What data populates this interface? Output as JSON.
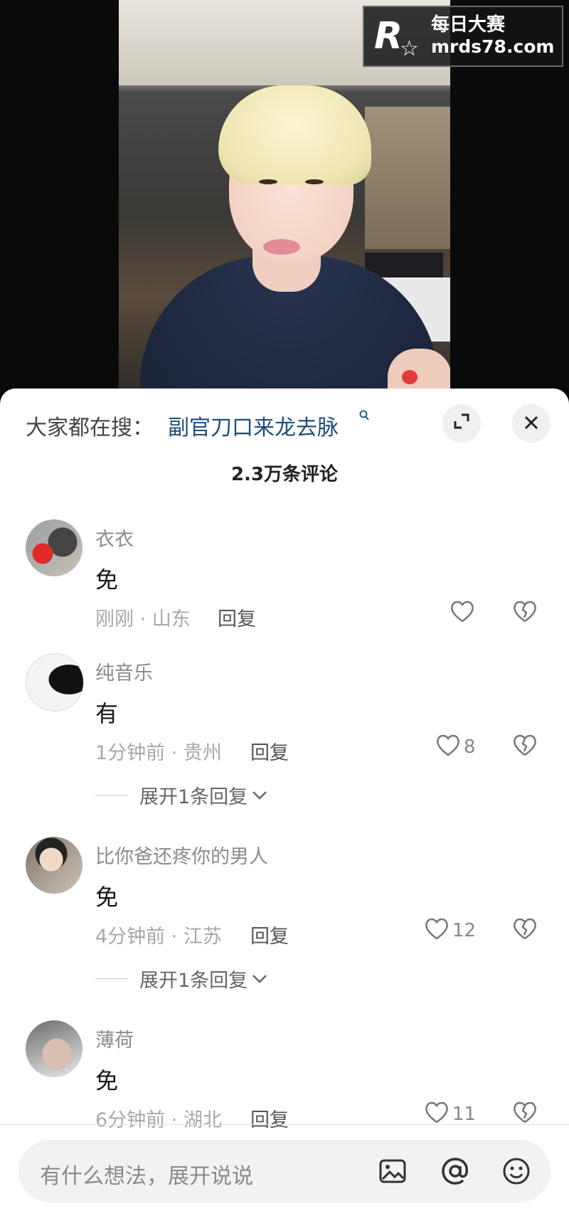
{
  "watermark": {
    "logo_letter": "R",
    "cn_text": "每日大赛",
    "url": "mrds78.com"
  },
  "sheet": {
    "search_prefix": "大家都在搜：",
    "search_query": "副官刀口来龙去脉",
    "comment_count": "2.3万条评论"
  },
  "comments": [
    {
      "name": "衣衣",
      "text": "免",
      "time": "刚刚",
      "location": "山东",
      "reply_label": "回复",
      "likes": ""
    },
    {
      "name": "纯音乐",
      "text": "有",
      "time": "1分钟前",
      "location": "贵州",
      "reply_label": "回复",
      "likes": "8",
      "expand": "展开1条回复"
    },
    {
      "name": "比你爸还疼你的男人",
      "text": "免",
      "time": "4分钟前",
      "location": "江苏",
      "reply_label": "回复",
      "likes": "12",
      "expand": "展开1条回复"
    },
    {
      "name": "薄荷",
      "text": "免",
      "time": "6分钟前",
      "location": "湖北",
      "reply_label": "回复",
      "likes": "11"
    }
  ],
  "input": {
    "placeholder": "有什么想法，展开说说"
  },
  "icons": [
    "expand-icon",
    "close-icon",
    "heart-icon",
    "broken-heart-icon",
    "image-icon",
    "at-icon",
    "emoji-icon"
  ]
}
